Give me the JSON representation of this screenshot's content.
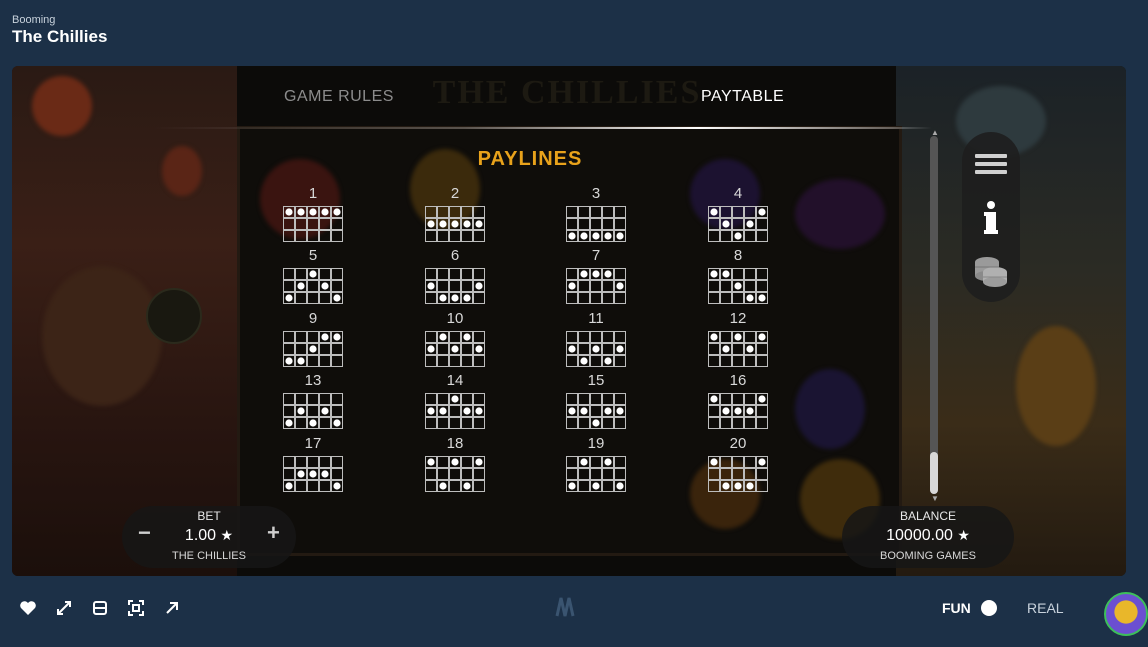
{
  "header": {
    "provider": "Booming",
    "title": "The Chillies"
  },
  "background": {
    "logo_text": "THE CHILLIES"
  },
  "tabs": [
    {
      "label": "GAME RULES",
      "active": false
    },
    {
      "label": "PAYTABLE",
      "active": true
    }
  ],
  "paytable": {
    "section_title": "PAYLINES",
    "paylines": [
      {
        "number": "1",
        "rows": [
          0,
          0,
          0,
          0,
          0
        ]
      },
      {
        "number": "2",
        "rows": [
          1,
          1,
          1,
          1,
          1
        ]
      },
      {
        "number": "3",
        "rows": [
          2,
          2,
          2,
          2,
          2
        ]
      },
      {
        "number": "4",
        "rows": [
          0,
          1,
          2,
          1,
          0
        ]
      },
      {
        "number": "5",
        "rows": [
          2,
          1,
          0,
          1,
          2
        ]
      },
      {
        "number": "6",
        "rows": [
          1,
          2,
          2,
          2,
          1
        ]
      },
      {
        "number": "7",
        "rows": [
          1,
          0,
          0,
          0,
          1
        ]
      },
      {
        "number": "8",
        "rows": [
          0,
          0,
          1,
          2,
          2
        ]
      },
      {
        "number": "9",
        "rows": [
          2,
          2,
          1,
          0,
          0
        ]
      },
      {
        "number": "10",
        "rows": [
          1,
          0,
          1,
          0,
          1
        ]
      },
      {
        "number": "11",
        "rows": [
          1,
          2,
          1,
          2,
          1
        ]
      },
      {
        "number": "12",
        "rows": [
          0,
          1,
          0,
          1,
          0
        ]
      },
      {
        "number": "13",
        "rows": [
          2,
          1,
          2,
          1,
          2
        ]
      },
      {
        "number": "14",
        "rows": [
          1,
          1,
          0,
          1,
          1
        ]
      },
      {
        "number": "15",
        "rows": [
          1,
          1,
          2,
          1,
          1
        ]
      },
      {
        "number": "16",
        "rows": [
          0,
          1,
          1,
          1,
          0
        ]
      },
      {
        "number": "17",
        "rows": [
          2,
          1,
          1,
          1,
          2
        ]
      },
      {
        "number": "18",
        "rows": [
          0,
          2,
          0,
          2,
          0
        ]
      },
      {
        "number": "19",
        "rows": [
          2,
          0,
          2,
          0,
          2
        ]
      },
      {
        "number": "20",
        "rows": [
          0,
          2,
          2,
          2,
          0
        ]
      }
    ]
  },
  "side_menu": [
    {
      "icon": "hamburger-menu-icon"
    },
    {
      "icon": "info-icon"
    },
    {
      "icon": "coins-stack-icon"
    }
  ],
  "bet": {
    "label": "BET",
    "value": "1.00",
    "currency_icon": "★",
    "subtitle": "THE CHILLIES",
    "minus": "−",
    "plus": "+"
  },
  "balance": {
    "label": "BALANCE",
    "value": "10000.00",
    "currency_icon": "★",
    "subtitle": "BOOMING GAMES"
  },
  "bottom_bar": {
    "icons": [
      "heart-icon",
      "fullscreen-icon",
      "layout-icon",
      "screenshot-icon",
      "external-link-icon"
    ],
    "fun_label": "FUN",
    "real_label": "REAL"
  },
  "colors": {
    "page_bg": "#1c3047",
    "title_gold": "#e8a21b",
    "frame_bg": "#0c0b09"
  }
}
